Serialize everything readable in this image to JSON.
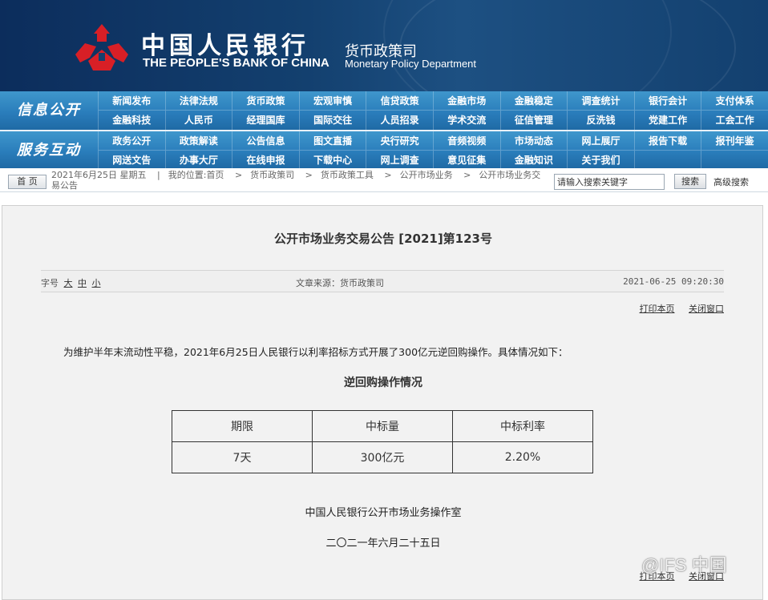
{
  "header": {
    "bank_name_cn": "中国人民银行",
    "bank_name_en": "THE PEOPLE'S BANK OF CHINA",
    "dept_cn": "货币政策司",
    "dept_en": "Monetary Policy Department"
  },
  "nav": {
    "section1_label": "信息公开",
    "section2_label": "服务互动",
    "row1": [
      "新闻发布",
      "法律法规",
      "货币政策",
      "宏观审慎",
      "信贷政策",
      "金融市场",
      "金融稳定",
      "调查统计",
      "银行会计",
      "支付体系",
      "金融科技",
      "人民币",
      "经理国库",
      "国际交往",
      "人员招录",
      "学术交流",
      "征信管理",
      "反洗钱",
      "党建工作",
      "工会工作"
    ],
    "row2": [
      "政务公开",
      "政策解读",
      "公告信息",
      "图文直播",
      "央行研究",
      "音频视频",
      "市场动态",
      "网上展厅",
      "报告下载",
      "报刊年鉴",
      "网送文告",
      "办事大厅",
      "在线申报",
      "下载中心",
      "网上调查",
      "意见征集",
      "金融知识",
      "关于我们",
      "",
      ""
    ]
  },
  "breadcrumb": {
    "home_label": "首 页",
    "date_text": "2021年6月25日 星期五",
    "location_label": "我的位置:",
    "items": [
      "首页",
      "货币政策司",
      "货币政策工具",
      "公开市场业务",
      "公开市场业务交"
    ],
    "wrap_text": "易公告",
    "search_placeholder": "请输入搜索关键字",
    "search_button": "搜索",
    "advanced_search": "高级搜索"
  },
  "article": {
    "title": "公开市场业务交易公告 [2021]第123号",
    "font_size_label": "字号",
    "font_sizes": [
      "大",
      "中",
      "小"
    ],
    "source": "文章来源：货币政策司",
    "datetime": "2021-06-25 09:20:30",
    "print_label": "打印本页",
    "close_label": "关闭窗口",
    "intro": "为维护半年末流动性平稳，2021年6月25日人民银行以利率招标方式开展了300亿元逆回购操作。具体情况如下：",
    "table_title": "逆回购操作情况",
    "table": {
      "headers": [
        "期限",
        "中标量",
        "中标利率"
      ],
      "rows": [
        [
          "7天",
          "300亿元",
          "2.20%"
        ]
      ]
    },
    "signature_org": "中国人民银行公开市场业务操作室",
    "signature_date": "二〇二一年六月二十五日"
  },
  "watermark": "@IFS 中国"
}
